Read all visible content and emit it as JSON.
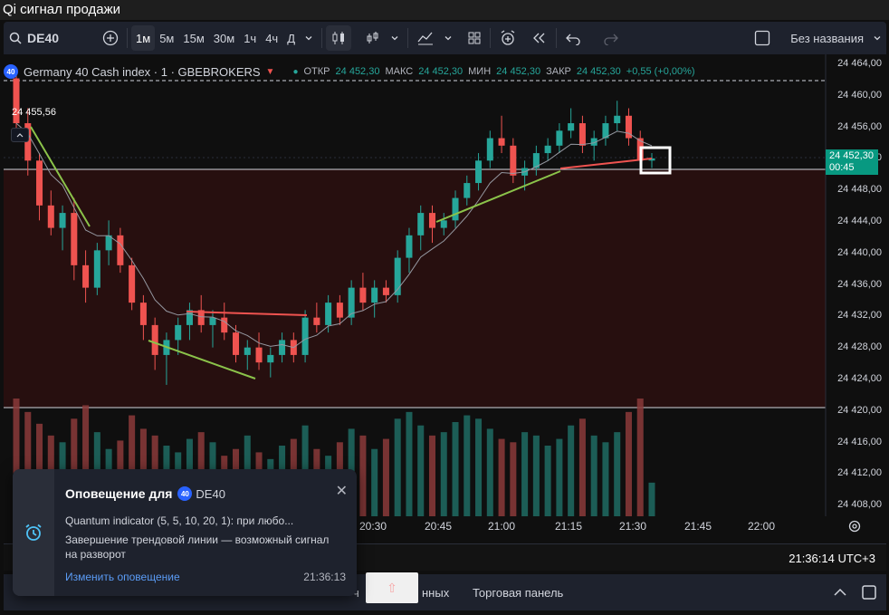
{
  "window": {
    "title": "Qi сигнал продажи"
  },
  "toolbar": {
    "symbol": "DE40",
    "intervals": [
      "1м",
      "5м",
      "15м",
      "30м",
      "1ч",
      "4ч",
      "Д"
    ],
    "active_interval": "1м",
    "layout_name": "Без названия"
  },
  "legend": {
    "instrument": "Germany 40 Cash index · 1 · GBEBROKERS",
    "badge": "40",
    "open_label": "ОТКР",
    "open": "24 452,30",
    "high_label": "МАКС",
    "high": "24 452,30",
    "low_label": "МИН",
    "low": "24 452,30",
    "close_label": "ЗАКР",
    "close": "24 452,30",
    "change": "+0,55 (+0,00%)"
  },
  "price_flag": "24 455,56",
  "current_price": {
    "price": "24 452,30",
    "countdown": "00:45"
  },
  "status": {
    "clock": "21:36:14 UTC+3"
  },
  "bottom_panel": {
    "tab_fragment_1": "ч",
    "tab_fragment_2": "нных",
    "tab_trading": "Торговая панель"
  },
  "toast": {
    "title": "Оповещение для",
    "symbol_badge": "40",
    "symbol": "DE40",
    "line1": "Quantum indicator (5, 5, 10, 20, 1): при любо...",
    "line2": "Завершение трендовой линии — возможный сигнал на разворот",
    "link": "Изменить оповещение",
    "time": "21:36:13"
  },
  "colors": {
    "up": "#26a69a",
    "down": "#ef5350",
    "accent": "#2962ff",
    "bg": "#0f0f0f"
  },
  "chart_data": {
    "type": "candlestick",
    "y_ticks": [
      "24 464,00",
      "24 460,00",
      "24 456,00",
      "24 452,00",
      "24 448,00",
      "24 444,00",
      "24 440,00",
      "24 436,00",
      "24 432,00",
      "24 428,00",
      "24 424,00",
      "24 420,00",
      "24 416,00",
      "24 412,00",
      "24 408,00"
    ],
    "x_ticks": [
      "20:30",
      "20:45",
      "21:00",
      "21:15",
      "21:30",
      "21:45",
      "22:00"
    ],
    "ylim": [
      24406,
      24465
    ],
    "candles": [
      [
        24463,
        24464,
        24455,
        24457
      ],
      [
        24457,
        24459,
        24450,
        24452
      ],
      [
        24452,
        24453,
        24444,
        24446
      ],
      [
        24446,
        24448,
        24442,
        24443
      ],
      [
        24443,
        24446,
        24440,
        24445
      ],
      [
        24445,
        24447,
        24436,
        24438
      ],
      [
        24438,
        24440,
        24433,
        24435
      ],
      [
        24435,
        24441,
        24434,
        24440
      ],
      [
        24440,
        24444,
        24438,
        24442
      ],
      [
        24442,
        24443,
        24437,
        24438
      ],
      [
        24438,
        24439,
        24432,
        24433
      ],
      [
        24433,
        24434,
        24428,
        24430
      ],
      [
        24430,
        24431,
        24424,
        24426
      ],
      [
        24426,
        24429,
        24422,
        24428
      ],
      [
        24428,
        24431,
        24426,
        24430
      ],
      [
        24430,
        24433,
        24428,
        24432
      ],
      [
        24432,
        24434,
        24429,
        24430
      ],
      [
        24430,
        24432,
        24427,
        24431
      ],
      [
        24431,
        24433,
        24428,
        24429
      ],
      [
        24429,
        24430,
        24425,
        24426
      ],
      [
        24426,
        24428,
        24424,
        24427
      ],
      [
        24427,
        24429,
        24424,
        24425
      ],
      [
        24425,
        24427,
        24423,
        24426
      ],
      [
        24426,
        24429,
        24425,
        24428
      ],
      [
        24428,
        24429,
        24425,
        24426
      ],
      [
        24426,
        24432,
        24425,
        24431
      ],
      [
        24431,
        24433,
        24429,
        24430
      ],
      [
        24430,
        24434,
        24429,
        24433
      ],
      [
        24433,
        24434,
        24430,
        24431
      ],
      [
        24431,
        24436,
        24430,
        24435
      ],
      [
        24435,
        24437,
        24432,
        24433
      ],
      [
        24433,
        24436,
        24431,
        24435
      ],
      [
        24435,
        24436,
        24433,
        24434
      ],
      [
        24434,
        24440,
        24433,
        24439
      ],
      [
        24439,
        24443,
        24437,
        24442
      ],
      [
        24442,
        24446,
        24440,
        24445
      ],
      [
        24445,
        24446,
        24441,
        24443
      ],
      [
        24443,
        24445,
        24442,
        24444
      ],
      [
        24444,
        24448,
        24443,
        24447
      ],
      [
        24447,
        24450,
        24446,
        24449
      ],
      [
        24449,
        24453,
        24448,
        24452
      ],
      [
        24452,
        24456,
        24451,
        24455
      ],
      [
        24455,
        24458,
        24453,
        24454
      ],
      [
        24454,
        24455,
        24449,
        24450
      ],
      [
        24450,
        24452,
        24448,
        24451
      ],
      [
        24451,
        24454,
        24450,
        24453
      ],
      [
        24453,
        24455,
        24452,
        24454
      ],
      [
        24454,
        24457,
        24453,
        24456
      ],
      [
        24456,
        24459,
        24455,
        24457
      ],
      [
        24457,
        24458,
        24453,
        24454
      ],
      [
        24454,
        24456,
        24452,
        24455
      ],
      [
        24455,
        24458,
        24454,
        24457
      ],
      [
        24457,
        24460,
        24456,
        24458
      ],
      [
        24458,
        24459,
        24454,
        24455
      ],
      [
        24455,
        24456,
        24451,
        24452
      ],
      [
        24452,
        24453,
        24451,
        24452.3
      ]
    ],
    "volumes": [
      70,
      62,
      55,
      48,
      44,
      58,
      66,
      50,
      40,
      45,
      60,
      52,
      48,
      42,
      38,
      46,
      50,
      44,
      36,
      40,
      48,
      38,
      34,
      42,
      46,
      54,
      40,
      36,
      44,
      52,
      48,
      40,
      46,
      58,
      62,
      54,
      48,
      50,
      56,
      60,
      58,
      52,
      46,
      44,
      50,
      48,
      42,
      46,
      54,
      58,
      48,
      44,
      50,
      62,
      70,
      20
    ]
  }
}
